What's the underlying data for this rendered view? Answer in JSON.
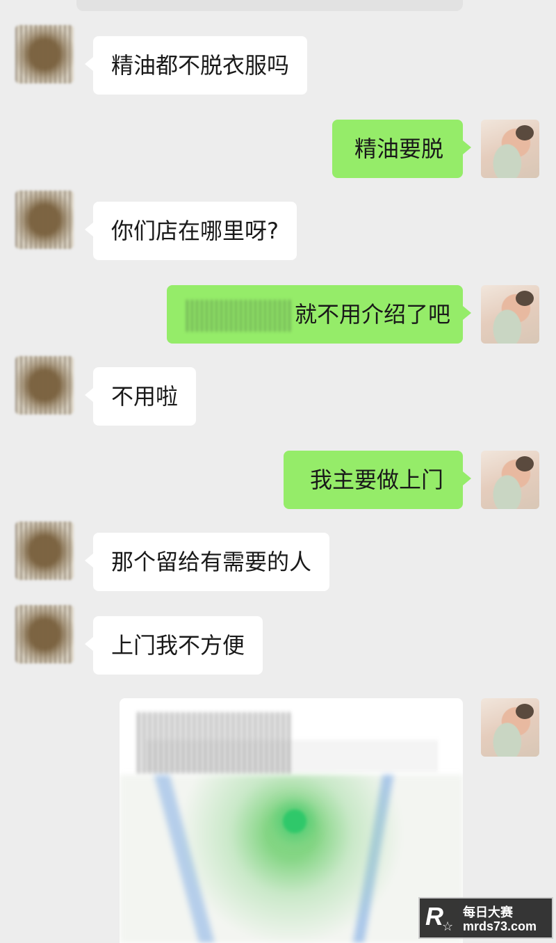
{
  "messages": [
    {
      "side": "left",
      "text": "精油都不脱衣服吗"
    },
    {
      "side": "right",
      "text": "精油要脱"
    },
    {
      "side": "left",
      "text": "你们店在哪里呀?"
    },
    {
      "side": "right",
      "text": "就不用介绍了吧"
    },
    {
      "side": "left",
      "text": "不用啦"
    },
    {
      "side": "right",
      "text": "我主要做上门"
    },
    {
      "side": "left",
      "text": "那个留给有需要的人"
    },
    {
      "side": "left",
      "text": "上门我不方便"
    }
  ],
  "watermark": {
    "logo": "R",
    "star": "☆",
    "name": "每日大赛",
    "url": "mrds73.com"
  }
}
